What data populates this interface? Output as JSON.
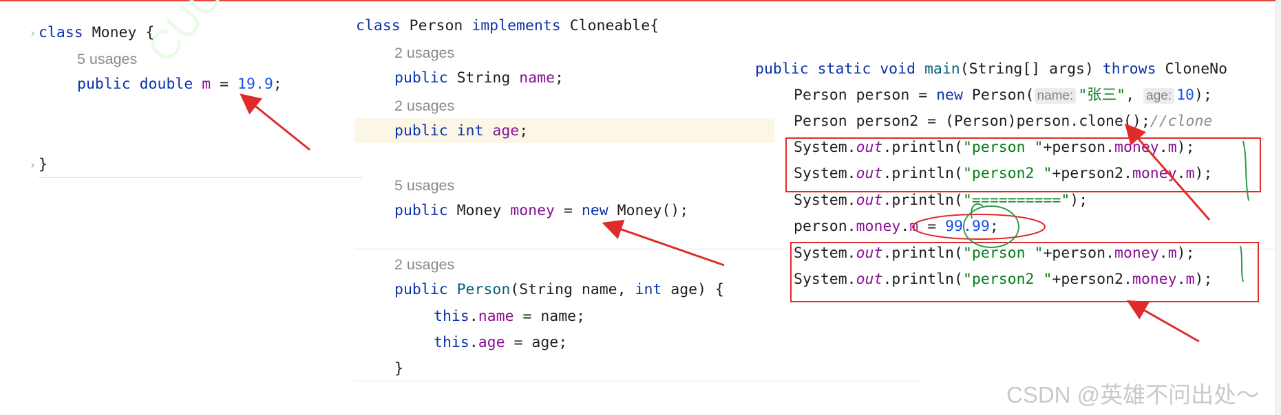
{
  "money_panel": {
    "l1": {
      "kw": "class",
      "rest": " Money {"
    },
    "usage": "5 usages",
    "l2": {
      "kw1": "public",
      "kw2": " double",
      "field": " m",
      "eq": " = ",
      "num": "19.9",
      "end": ";"
    },
    "close": "}"
  },
  "person_panel": {
    "header": {
      "kw": "class",
      "name": " Person ",
      "kw2": "implements",
      "rest": " Cloneable{"
    },
    "usage_name": "2 usages",
    "name_decl": {
      "kw": "public",
      "type": " String ",
      "field": "name",
      "end": ";"
    },
    "usage_age": "2 usages",
    "age_decl": {
      "kw": "public",
      "kw2": " int ",
      "field": "age",
      "end": ";"
    },
    "usage_money": "5 usages",
    "money_decl": {
      "kw": "public",
      "type": " Money ",
      "field": "money",
      "eq": " = ",
      "kw2": "new",
      "rest": " Money();"
    },
    "usage_ctor": "2 usages",
    "ctor": {
      "kw": "public",
      "name": " Person",
      "rest1": "(String name, ",
      "kw2": "int",
      "rest2": " age) {"
    },
    "this_name": {
      "kw": "this",
      "dot": ".",
      "field": "name",
      "rest": " = name;"
    },
    "this_age": {
      "kw": "this",
      "dot": ".",
      "field": "age",
      "rest": " = age;"
    },
    "close": "}"
  },
  "main_panel": {
    "sig": {
      "kw": "public static void",
      "name": " main",
      "rest": "(String[] args) ",
      "kw2": "throws",
      "rest2": " CloneNo"
    },
    "l1": {
      "a": "Person person = ",
      "kw": "new",
      "b": " Person(",
      "hint1": "name:",
      "s1": "\"张三\"",
      "c": ",",
      "hint2": "age:",
      "n": "10",
      "d": ");"
    },
    "l2": {
      "a": "Person person2 = (Person)person.clone();",
      "cmt": "//clone"
    },
    "l3": {
      "a": "System.",
      "out": "out",
      "b": ".println(",
      "s": "\"person \"",
      "c": "+person.",
      "f1": "money",
      "d": ".",
      "f2": "m",
      "e": ");"
    },
    "l4": {
      "a": "System.",
      "out": "out",
      "b": ".println(",
      "s": "\"person2 \"",
      "c": "+person2.",
      "f1": "money",
      "d": ".",
      "f2": "m",
      "e": ");"
    },
    "l5": {
      "a": "System.",
      "out": "out",
      "b": ".println(",
      "s": "\"==========\"",
      "e": ");"
    },
    "l6": {
      "a": "person.",
      "f1": "money",
      "d": ".",
      "f2": "m",
      "eq": " = ",
      "n": "99.99",
      "e": ";"
    },
    "l7": {
      "a": "System.",
      "out": "out",
      "b": ".println(",
      "s": "\"person \"",
      "c": "+person.",
      "f1": "money",
      "d": ".",
      "f2": "m",
      "e": ");"
    },
    "l8": {
      "a": "System.",
      "out": "out",
      "b": ".println(",
      "s": "\"person2 \"",
      "c": "+person2.",
      "f1": "money",
      "d": ".",
      "f2": "m",
      "e": ");"
    }
  },
  "watermark": "CSDN @英雄不问出处～",
  "colors": {
    "keyword": "#0b33a8",
    "field": "#871094",
    "number": "#1750eb",
    "string": "#067d17",
    "annotation_red": "#e02b2b",
    "annotation_green": "#2e9a4a"
  }
}
